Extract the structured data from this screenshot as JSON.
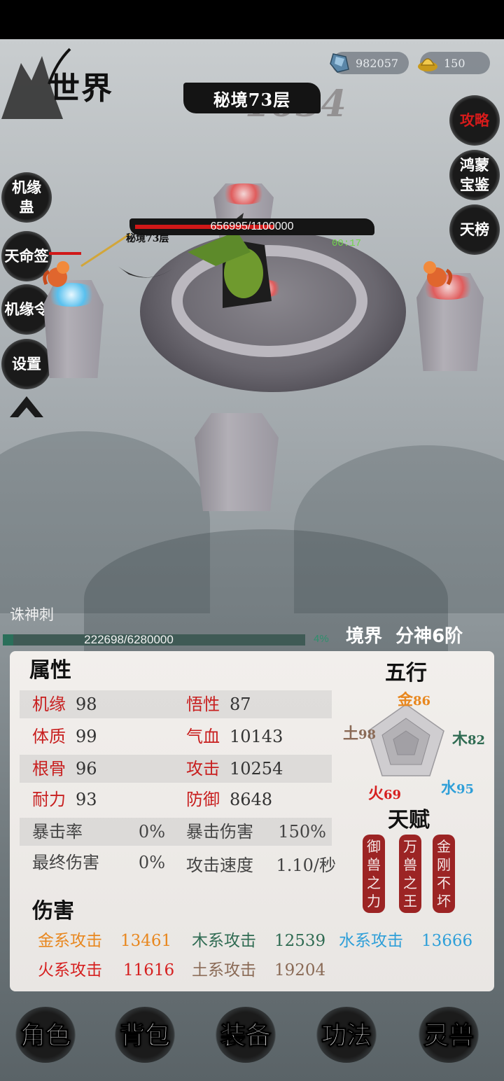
{
  "header": {
    "title": "世界"
  },
  "currency": [
    {
      "icon": "blue-crystal-icon",
      "value": "982057"
    },
    {
      "icon": "gold-ingot-icon",
      "value": "150"
    }
  ],
  "stage": {
    "name": "秘境73层",
    "ghost_number": "1634"
  },
  "right_menu": [
    {
      "label": "攻略",
      "color": "#d61b1b"
    },
    {
      "label": "鸿蒙宝鉴"
    },
    {
      "label": "天榜"
    }
  ],
  "left_menu": [
    {
      "label": "机缘蛊"
    },
    {
      "label": "天命签"
    },
    {
      "label": "机缘令"
    },
    {
      "label": "设置"
    }
  ],
  "boss": {
    "hp_text": "656995/1100000",
    "hp_current": 656995,
    "hp_max": 1100000,
    "stage_label": "秘境73层",
    "timer": "00:17"
  },
  "player": {
    "skill": "诛神刺",
    "exp_text": "222698/6280000",
    "exp_current": 222698,
    "exp_max": 6280000,
    "exp_pct": "4%",
    "realm_label": "境界",
    "realm_value": "分神6阶"
  },
  "attributes": {
    "title": "属性",
    "rows": [
      {
        "l1": "机缘",
        "v1": "98",
        "l2": "悟性",
        "v2": "87"
      },
      {
        "l1": "体质",
        "v1": "99",
        "l2": "气血",
        "v2": "10143"
      },
      {
        "l1": "根骨",
        "v1": "96",
        "l2": "攻击",
        "v2": "10254"
      },
      {
        "l1": "耐力",
        "v1": "93",
        "l2": "防御",
        "v2": "8648"
      },
      {
        "l1": "暴击率",
        "v1": "0%",
        "l2": "暴击伤害",
        "v2": "150%"
      },
      {
        "l1": "最终伤害",
        "v1": "0%",
        "l2": "攻击速度",
        "v2": "1.10/秒"
      }
    ]
  },
  "wuxing": {
    "title": "五行",
    "jin": {
      "label": "金",
      "value": "86",
      "color": "#e8871e"
    },
    "mu": {
      "label": "木",
      "value": "82",
      "color": "#2f6b52"
    },
    "shui": {
      "label": "水",
      "value": "95",
      "color": "#2e9fd8"
    },
    "huo": {
      "label": "火",
      "value": "69",
      "color": "#d62020"
    },
    "tu": {
      "label": "土",
      "value": "98",
      "color": "#8a6a56"
    }
  },
  "talent": {
    "title": "天赋",
    "items": [
      "御兽之力",
      "万兽之王",
      "金刚不坏"
    ]
  },
  "damage": {
    "title": "伤害",
    "items": [
      {
        "label": "金系攻击",
        "value": "13461",
        "color": "#e8871e"
      },
      {
        "label": "木系攻击",
        "value": "12539",
        "color": "#2f6b52"
      },
      {
        "label": "水系攻击",
        "value": "13666",
        "color": "#2e9fd8"
      },
      {
        "label": "火系攻击",
        "value": "11616",
        "color": "#d62020"
      },
      {
        "label": "土系攻击",
        "value": "19204",
        "color": "#8a6a56"
      }
    ]
  },
  "nav": [
    "角色",
    "背包",
    "装备",
    "功法",
    "灵兽"
  ]
}
